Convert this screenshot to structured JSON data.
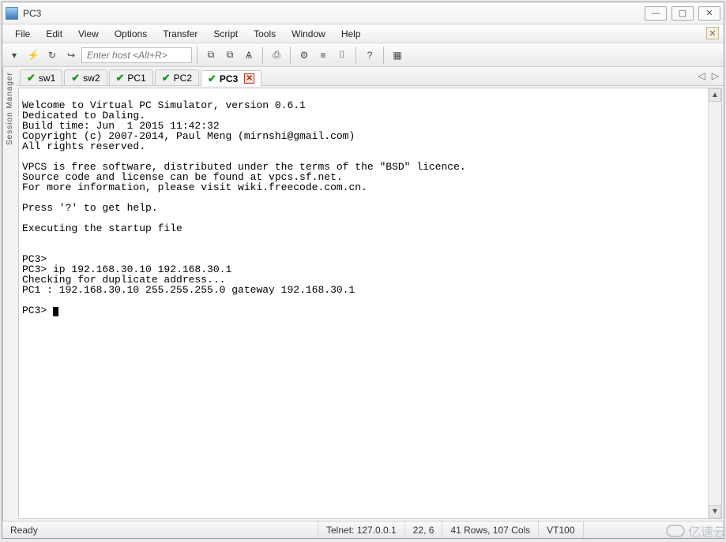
{
  "window": {
    "title": "PC3"
  },
  "menubar": [
    "File",
    "Edit",
    "View",
    "Options",
    "Transfer",
    "Script",
    "Tools",
    "Window",
    "Help"
  ],
  "toolbar": {
    "host_placeholder": "Enter host <Alt+R>",
    "icons": {
      "menu_drop": "▾",
      "lightning": "⚡",
      "refresh": "↻",
      "link": "↪",
      "copy": "⧉",
      "paste": "⧉",
      "find": "Ѧ",
      "print": "⎙",
      "gear": "⚙",
      "ruler": "≡",
      "key": "⌷",
      "help": "?",
      "palette": "▦"
    }
  },
  "side_panel_label": "Session Manager",
  "tabs": [
    {
      "label": "sw1",
      "active": false
    },
    {
      "label": "sw2",
      "active": false
    },
    {
      "label": "PC1",
      "active": false
    },
    {
      "label": "PC2",
      "active": false
    },
    {
      "label": "PC3",
      "active": true
    }
  ],
  "terminal_text": "\nWelcome to Virtual PC Simulator, version 0.6.1\nDedicated to Daling.\nBuild time: Jun  1 2015 11:42:32\nCopyright (c) 2007-2014, Paul Meng (mirnshi@gmail.com)\nAll rights reserved.\n\nVPCS is free software, distributed under the terms of the \"BSD\" licence.\nSource code and license can be found at vpcs.sf.net.\nFor more information, please visit wiki.freecode.com.cn.\n\nPress '?' to get help.\n\nExecuting the startup file\n\n\nPC3>\nPC3> ip 192.168.30.10 192.168.30.1\nChecking for duplicate address...\nPC1 : 192.168.30.10 255.255.255.0 gateway 192.168.30.1\n\nPC3> ",
  "status": {
    "ready": "Ready",
    "conn": "Telnet: 127.0.0.1",
    "pos": "22,  6",
    "size": "41 Rows, 107 Cols",
    "term": "VT100"
  },
  "watermark": "亿速云"
}
